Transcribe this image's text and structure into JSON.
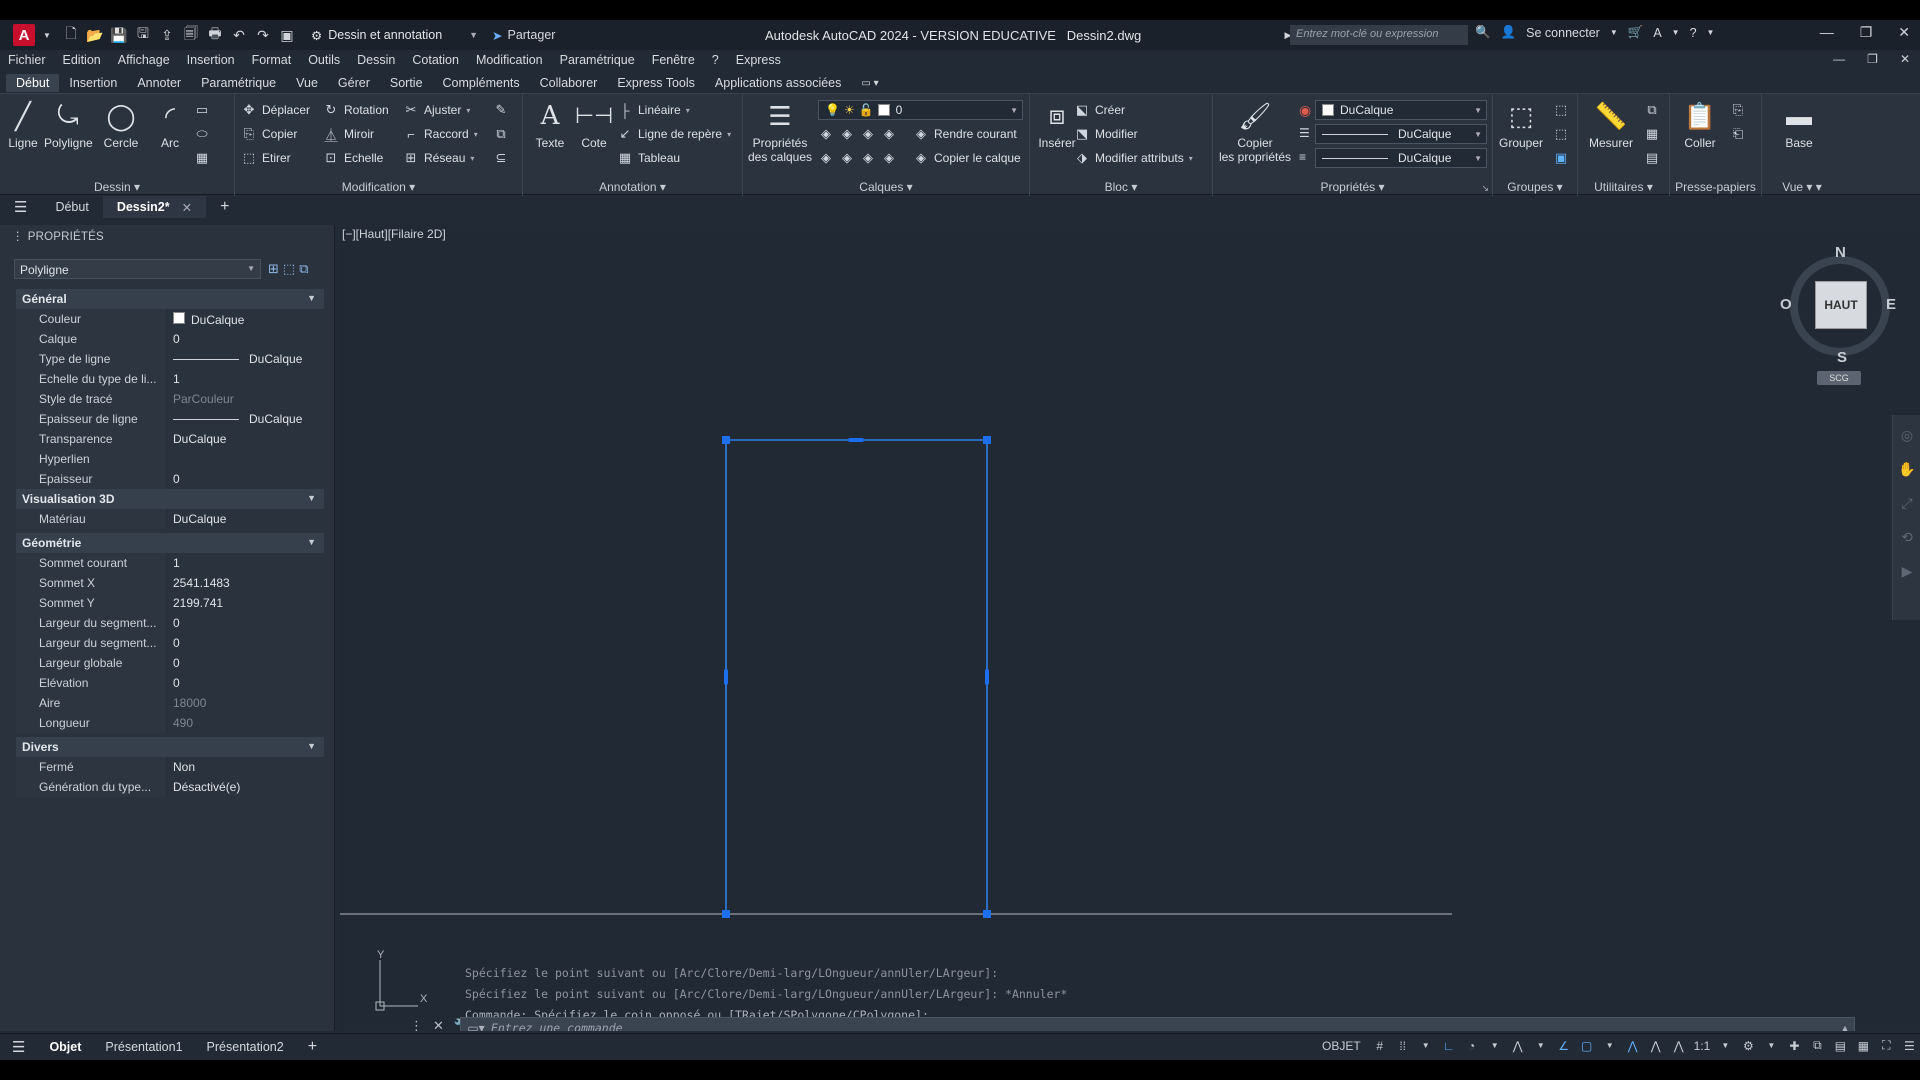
{
  "titlebar": {
    "app_logo": "A",
    "workspace": "Dessin et annotation",
    "share": "Partager",
    "title": "Autodesk AutoCAD 2024 - VERSION EDUCATIVE",
    "filename": "Dessin2.dwg",
    "search_placeholder": "Entrez mot-clé ou expression",
    "signin": "Se connecter"
  },
  "menubar": [
    "Fichier",
    "Edition",
    "Affichage",
    "Insertion",
    "Format",
    "Outils",
    "Dessin",
    "Cotation",
    "Modification",
    "Paramétrique",
    "Fenêtre",
    "?",
    "Express"
  ],
  "ribbon_tabs": [
    "Début",
    "Insertion",
    "Annoter",
    "Paramétrique",
    "Vue",
    "Gérer",
    "Sortie",
    "Compléments",
    "Collaborer",
    "Express Tools",
    "Applications associées"
  ],
  "ribbon": {
    "dessin": {
      "title": "Dessin",
      "ligne": "Ligne",
      "polyligne": "Polyligne",
      "cercle": "Cercle",
      "arc": "Arc"
    },
    "modification": {
      "title": "Modification",
      "deplacer": "Déplacer",
      "rotation": "Rotation",
      "ajuster": "Ajuster",
      "copier": "Copier",
      "miroir": "Miroir",
      "raccord": "Raccord",
      "etirer": "Etirer",
      "echelle": "Echelle",
      "reseau": "Réseau"
    },
    "annotation": {
      "title": "Annotation",
      "texte": "Texte",
      "cote": "Cote",
      "lineaire": "Linéaire",
      "ligne_repere": "Ligne de repère",
      "tableau": "Tableau"
    },
    "calques": {
      "title": "Calques",
      "proprietes_l1": "Propriétés",
      "proprietes_l2": "des calques",
      "layer_value": "0",
      "rendre_courant": "Rendre courant",
      "copier_calque": "Copier le calque"
    },
    "bloc": {
      "title": "Bloc",
      "inserer": "Insérer",
      "creer": "Créer",
      "modifier": "Modifier",
      "modifier_attributs": "Modifier attributs"
    },
    "proprietes": {
      "title": "Propriétés",
      "copier_l1": "Copier",
      "copier_l2": "les propriétés",
      "color": "DuCalque",
      "linetype": "DuCalque",
      "lineweight": "DuCalque"
    },
    "groupes": {
      "title": "Groupes",
      "grouper": "Grouper"
    },
    "utilitaires": {
      "title": "Utilitaires",
      "mesurer": "Mesurer"
    },
    "presse_papiers": {
      "title": "Presse-papiers",
      "coller": "Coller"
    },
    "vue": {
      "title": "Vue",
      "base": "Base"
    }
  },
  "doctabs": {
    "debut": "Début",
    "active": "Dessin2*"
  },
  "properties": {
    "header": "PROPRIÉTÉS",
    "object_type": "Polyligne",
    "sections": {
      "general": "Général",
      "vis3d": "Visualisation 3D",
      "geometrie": "Géométrie",
      "divers": "Divers"
    },
    "general": [
      [
        "Couleur",
        "DuCalque"
      ],
      [
        "Calque",
        "0"
      ],
      [
        "Type de ligne",
        "DuCalque"
      ],
      [
        "Echelle du type de li...",
        "1"
      ],
      [
        "Style de tracé",
        "ParCouleur"
      ],
      [
        "Epaisseur de ligne",
        "DuCalque"
      ],
      [
        "Transparence",
        "DuCalque"
      ],
      [
        "Hyperlien",
        ""
      ],
      [
        "Epaisseur",
        "0"
      ]
    ],
    "vis3d": [
      [
        "Matériau",
        "DuCalque"
      ]
    ],
    "geometrie": [
      [
        "Sommet courant",
        "1"
      ],
      [
        "Sommet X",
        "2541.1483"
      ],
      [
        "Sommet Y",
        "2199.741"
      ],
      [
        "Largeur du segment...",
        "0"
      ],
      [
        "Largeur du segment...",
        "0"
      ],
      [
        "Largeur globale",
        "0"
      ],
      [
        "Elévation",
        "0"
      ],
      [
        "Aire",
        "18000"
      ],
      [
        "Longueur",
        "490"
      ]
    ],
    "divers": [
      [
        "Fermé",
        "Non"
      ],
      [
        "Génération du type...",
        "Désactivé(e)"
      ]
    ]
  },
  "viewport": {
    "label": "[−][Haut][Filaire 2D]",
    "viewcube": {
      "face": "HAUT",
      "n": "N",
      "s": "S",
      "e": "E",
      "o": "O"
    },
    "scu": "SCG",
    "ucs_y": "Y",
    "ucs_x": "X"
  },
  "command": {
    "history": [
      "Spécifiez le point suivant ou [Arc/Clore/Demi-larg/LOngueur/annUler/LArgeur]:",
      "Spécifiez le point suivant ou [Arc/Clore/Demi-larg/LOngueur/annUler/LArgeur]: *Annuler*",
      "Commande: Spécifiez le coin opposé ou [TRajet/SPolygone/CPolygone]:"
    ],
    "placeholder": "Entrez une commande"
  },
  "statusbar": {
    "tabs": [
      "Objet",
      "Présentation1",
      "Présentation2"
    ],
    "mode": "OBJET",
    "scale": "1:1"
  },
  "colors": {
    "selection": "#2f7fe6",
    "grip": "#1e6ff0",
    "background": "#212935"
  }
}
